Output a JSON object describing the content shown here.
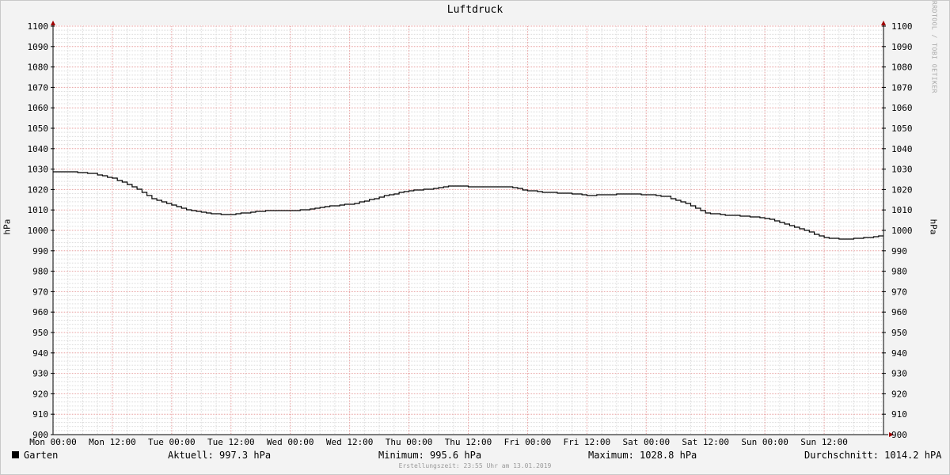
{
  "chart_data": {
    "type": "line",
    "title": "Luftdruck",
    "ylabel": "hPa",
    "ylabel_right": "hPa",
    "ylim": [
      900,
      1100
    ],
    "yticks": [
      900,
      910,
      920,
      930,
      940,
      950,
      960,
      970,
      980,
      990,
      1000,
      1010,
      1020,
      1030,
      1040,
      1050,
      1060,
      1070,
      1080,
      1090,
      1100
    ],
    "x_ticks": [
      "Mon 00:00",
      "Mon 12:00",
      "Tue 00:00",
      "Tue 12:00",
      "Wed 00:00",
      "Wed 12:00",
      "Thu 00:00",
      "Thu 12:00",
      "Fri 00:00",
      "Fri 12:00",
      "Sat 00:00",
      "Sat 12:00",
      "Sun 00:00",
      "Sun 12:00"
    ],
    "x_unit": "hours since Mon 00:00",
    "xlim": [
      0,
      168
    ],
    "grid": true,
    "series": [
      {
        "name": "Garten",
        "color": "#000000",
        "x": [
          0,
          4,
          8,
          12,
          16,
          20,
          24,
          28,
          32,
          36,
          40,
          44,
          48,
          52,
          56,
          60,
          64,
          68,
          72,
          76,
          80,
          84,
          88,
          92,
          96,
          100,
          104,
          108,
          112,
          116,
          120,
          124,
          128,
          132,
          136,
          140,
          144,
          148,
          152,
          156,
          160,
          164,
          168
        ],
        "values": [
          1028.8,
          1028.6,
          1027.8,
          1025.5,
          1021.5,
          1015.5,
          1012.5,
          1009.5,
          1008.0,
          1007.8,
          1009.0,
          1009.8,
          1009.5,
          1010.3,
          1012.0,
          1012.8,
          1015.0,
          1017.5,
          1019.5,
          1020.3,
          1021.8,
          1021.5,
          1021.3,
          1021.3,
          1019.5,
          1018.5,
          1018.3,
          1017.0,
          1017.5,
          1017.8,
          1017.5,
          1016.5,
          1013.0,
          1008.5,
          1007.5,
          1007.0,
          1006.0,
          1003.0,
          1000.0,
          996.5,
          995.6,
          996.5,
          997.3
        ]
      }
    ],
    "legend": {
      "series_name": "Garten",
      "current": "Aktuell: 997.3 hPa",
      "minimum": "Minimum: 995.6 hPa",
      "maximum": "Maximum: 1028.8 hPa",
      "average": "Durchschnitt: 1014.2 hPA"
    },
    "footer": "Erstellungszeit: 23:55 Uhr am 13.01.2019",
    "watermark": "RRDTOOL / TOBI OETIKER"
  }
}
